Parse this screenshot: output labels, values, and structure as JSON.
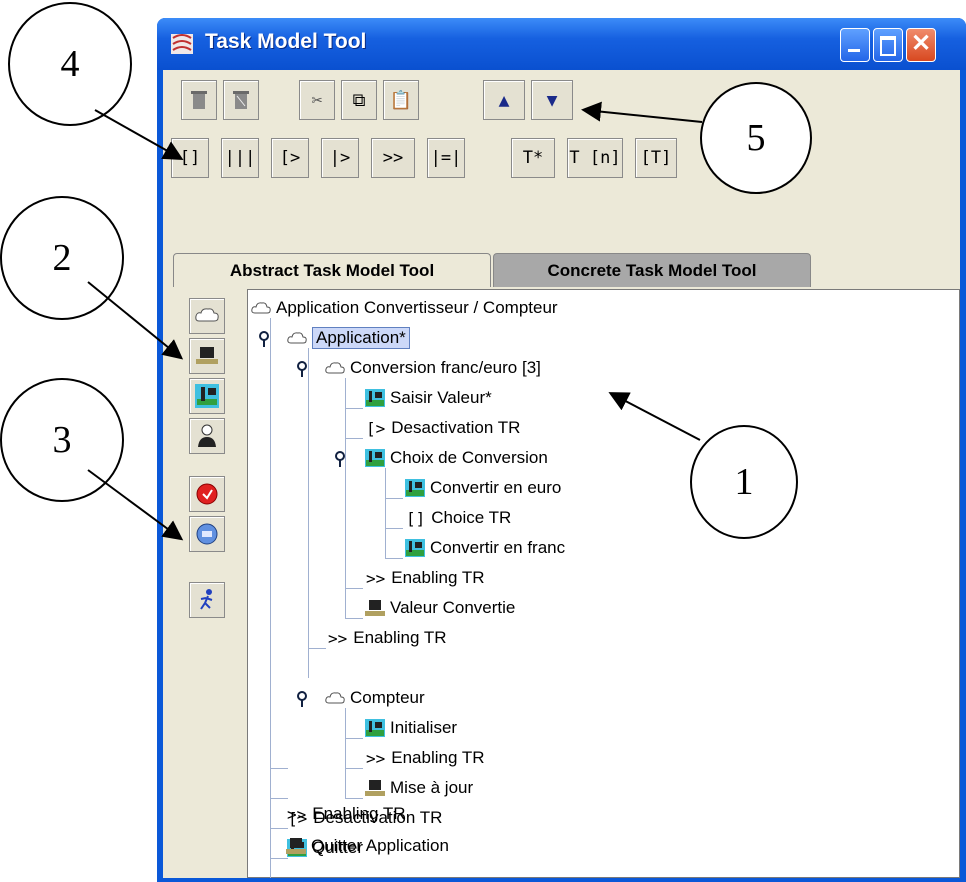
{
  "window": {
    "title": "Task Model Tool"
  },
  "toolbar": {
    "row2": [
      "[]",
      "|||",
      "[>",
      "|>",
      ">>",
      "|=|",
      "T*",
      "T [n]",
      "[T]"
    ]
  },
  "tabs": [
    "Abstract Task Model Tool",
    "Concrete Task Model Tool"
  ],
  "tree": {
    "root": "Application Convertisseur / Compteur",
    "app": "Application*",
    "conversion": "Conversion franc/euro [3]",
    "saisir": "Saisir Valeur*",
    "desact1_op": "[>",
    "desact1": "Desactivation TR",
    "choix": "Choix de Conversion",
    "conv_euro": "Convertir en euro",
    "choice_op": "[]",
    "choice": "Choice TR",
    "conv_franc": "Convertir en franc",
    "enab1_op": ">>",
    "enab1": "Enabling TR",
    "valeur": "Valeur Convertie",
    "enab2_op": ">>",
    "enab2": "Enabling TR",
    "compteur": "Compteur",
    "init": "Initialiser",
    "enab3_op": ">>",
    "enab3": "Enabling TR",
    "maj": "Mise à jour",
    "desact2_op": "[>",
    "desact2": "Desactivation TR",
    "quitter": "Quitter",
    "enab4_op": ">>",
    "enab4": "Enabling TR",
    "quitter_app": "Quitter Application"
  },
  "callouts": [
    "4",
    "5",
    "2",
    "3",
    "1"
  ]
}
